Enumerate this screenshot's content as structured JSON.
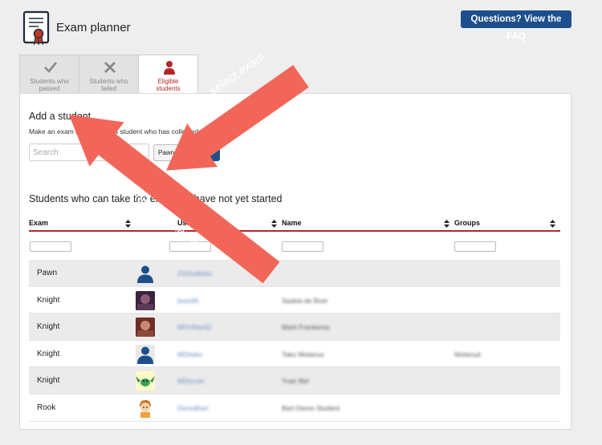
{
  "header": {
    "app_title": "Exam planner",
    "faq_label": "Questions? View the FAQ"
  },
  "tabs": [
    {
      "label_line1": "Students who",
      "label_line2": "passed",
      "icon": "check-icon",
      "active": false
    },
    {
      "label_line1": "Students who",
      "label_line2": "failed",
      "icon": "cross-icon",
      "active": false
    },
    {
      "label_line1": "Eligible",
      "label_line2": "students",
      "icon": "person-icon",
      "active": true
    }
  ],
  "add_student": {
    "title": "Add a student",
    "description": "Make an exam available for a student who has collected all stickers",
    "search_placeholder": "Search",
    "exam_selected": "Pawn",
    "add_label": "Add"
  },
  "table": {
    "title": "Students who can take the exam but have not yet started",
    "columns": [
      "Exam",
      "Username",
      "Name",
      "Groups"
    ],
    "rows": [
      {
        "exam": "Pawn",
        "avatar": "default-person-avatar",
        "username": "ZSGwillebo",
        "name": "",
        "group": ""
      },
      {
        "exam": "Knight",
        "avatar": "photo-avatar",
        "username": "boer65",
        "name": "Saskia de Boer",
        "group": ""
      },
      {
        "exam": "Knight",
        "avatar": "photo-avatar",
        "username": "MDVMarit2",
        "name": "Marit Frankema",
        "group": ""
      },
      {
        "exam": "Knight",
        "avatar": "default-person-avatar",
        "username": "MDitako",
        "name": "Tako Molanus",
        "group": "Molanud"
      },
      {
        "exam": "Knight",
        "avatar": "dragon-avatar",
        "username": "MDtyvan",
        "name": "Yvan Bel",
        "group": ""
      },
      {
        "exam": "Rook",
        "avatar": "cartoon-boy-avatar",
        "username": "DemoBart",
        "name": "Bart Demo Student",
        "group": ""
      }
    ]
  },
  "annotations": {
    "select_exam": "select exam",
    "enter_username": "enter username",
    "arrow_color": "#f2665a"
  },
  "colors": {
    "brand_blue": "#1d4f8c",
    "accent_red": "#b3262a",
    "link_blue": "#6b8dc5"
  }
}
